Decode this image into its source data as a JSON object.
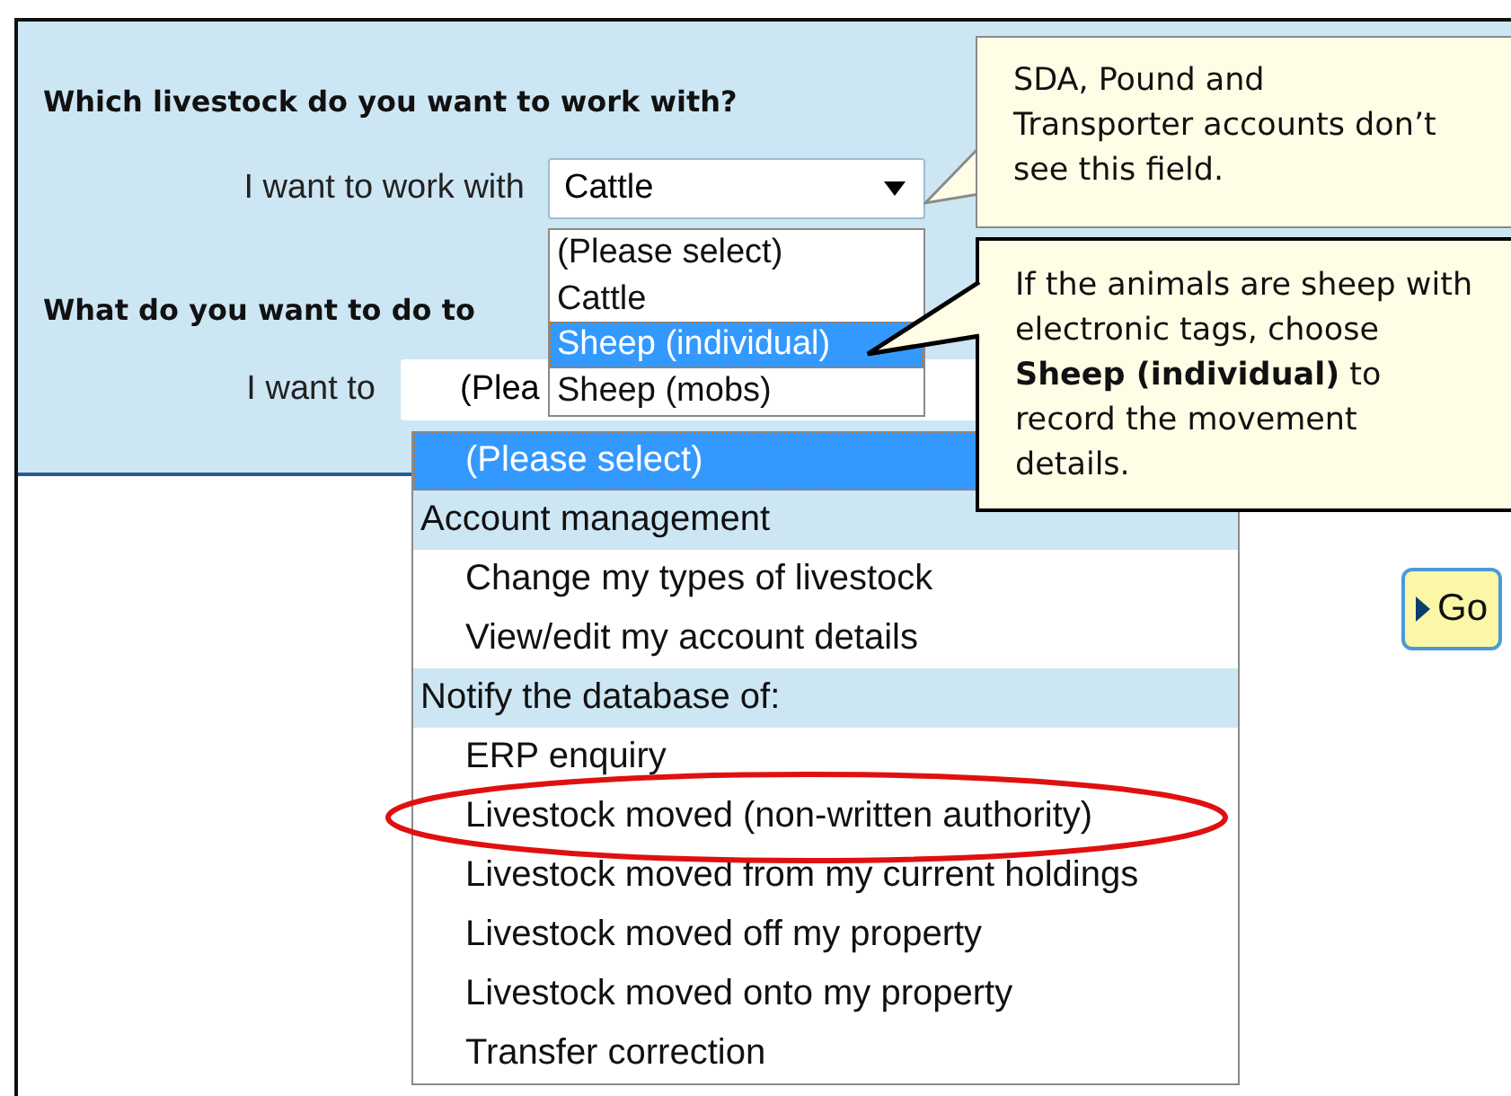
{
  "section1": {
    "heading": "Which livestock do you want to work with?",
    "label": "I want to work with",
    "select": {
      "value": "Cattle",
      "options": [
        {
          "label": "(Please select)",
          "highlighted": false
        },
        {
          "label": "Cattle",
          "highlighted": false
        },
        {
          "label": "Sheep (individual)",
          "highlighted": true
        },
        {
          "label": "Sheep (mobs)",
          "highlighted": false
        }
      ]
    }
  },
  "section2": {
    "heading": "What do you want to do to",
    "label": "I want to",
    "select": {
      "value": "(Plea",
      "options": [
        {
          "kind": "option",
          "label": "(Please select)",
          "selected": true,
          "circled": false
        },
        {
          "kind": "group",
          "label": "Account management"
        },
        {
          "kind": "option",
          "label": "Change my types of livestock",
          "selected": false,
          "circled": false
        },
        {
          "kind": "option",
          "label": "View/edit my account details",
          "selected": false,
          "circled": false
        },
        {
          "kind": "group",
          "label": "Notify the database of:"
        },
        {
          "kind": "option",
          "label": "ERP enquiry",
          "selected": false,
          "circled": false
        },
        {
          "kind": "option",
          "label": "Livestock moved (non-written authority)",
          "selected": false,
          "circled": true
        },
        {
          "kind": "option",
          "label": "Livestock moved from my current holdings",
          "selected": false,
          "circled": false
        },
        {
          "kind": "option",
          "label": "Livestock moved off my property",
          "selected": false,
          "circled": false
        },
        {
          "kind": "option",
          "label": "Livestock moved onto my property",
          "selected": false,
          "circled": false
        },
        {
          "kind": "option",
          "label": "Transfer correction",
          "selected": false,
          "circled": false
        }
      ]
    }
  },
  "go_button": "Go",
  "callouts": [
    {
      "text": "SDA, Pound and Transporter accounts don’t see this field."
    },
    {
      "text": "If the animals are sheep with electronic tags, choose **Sheep (individual)** to record the movement details."
    }
  ]
}
